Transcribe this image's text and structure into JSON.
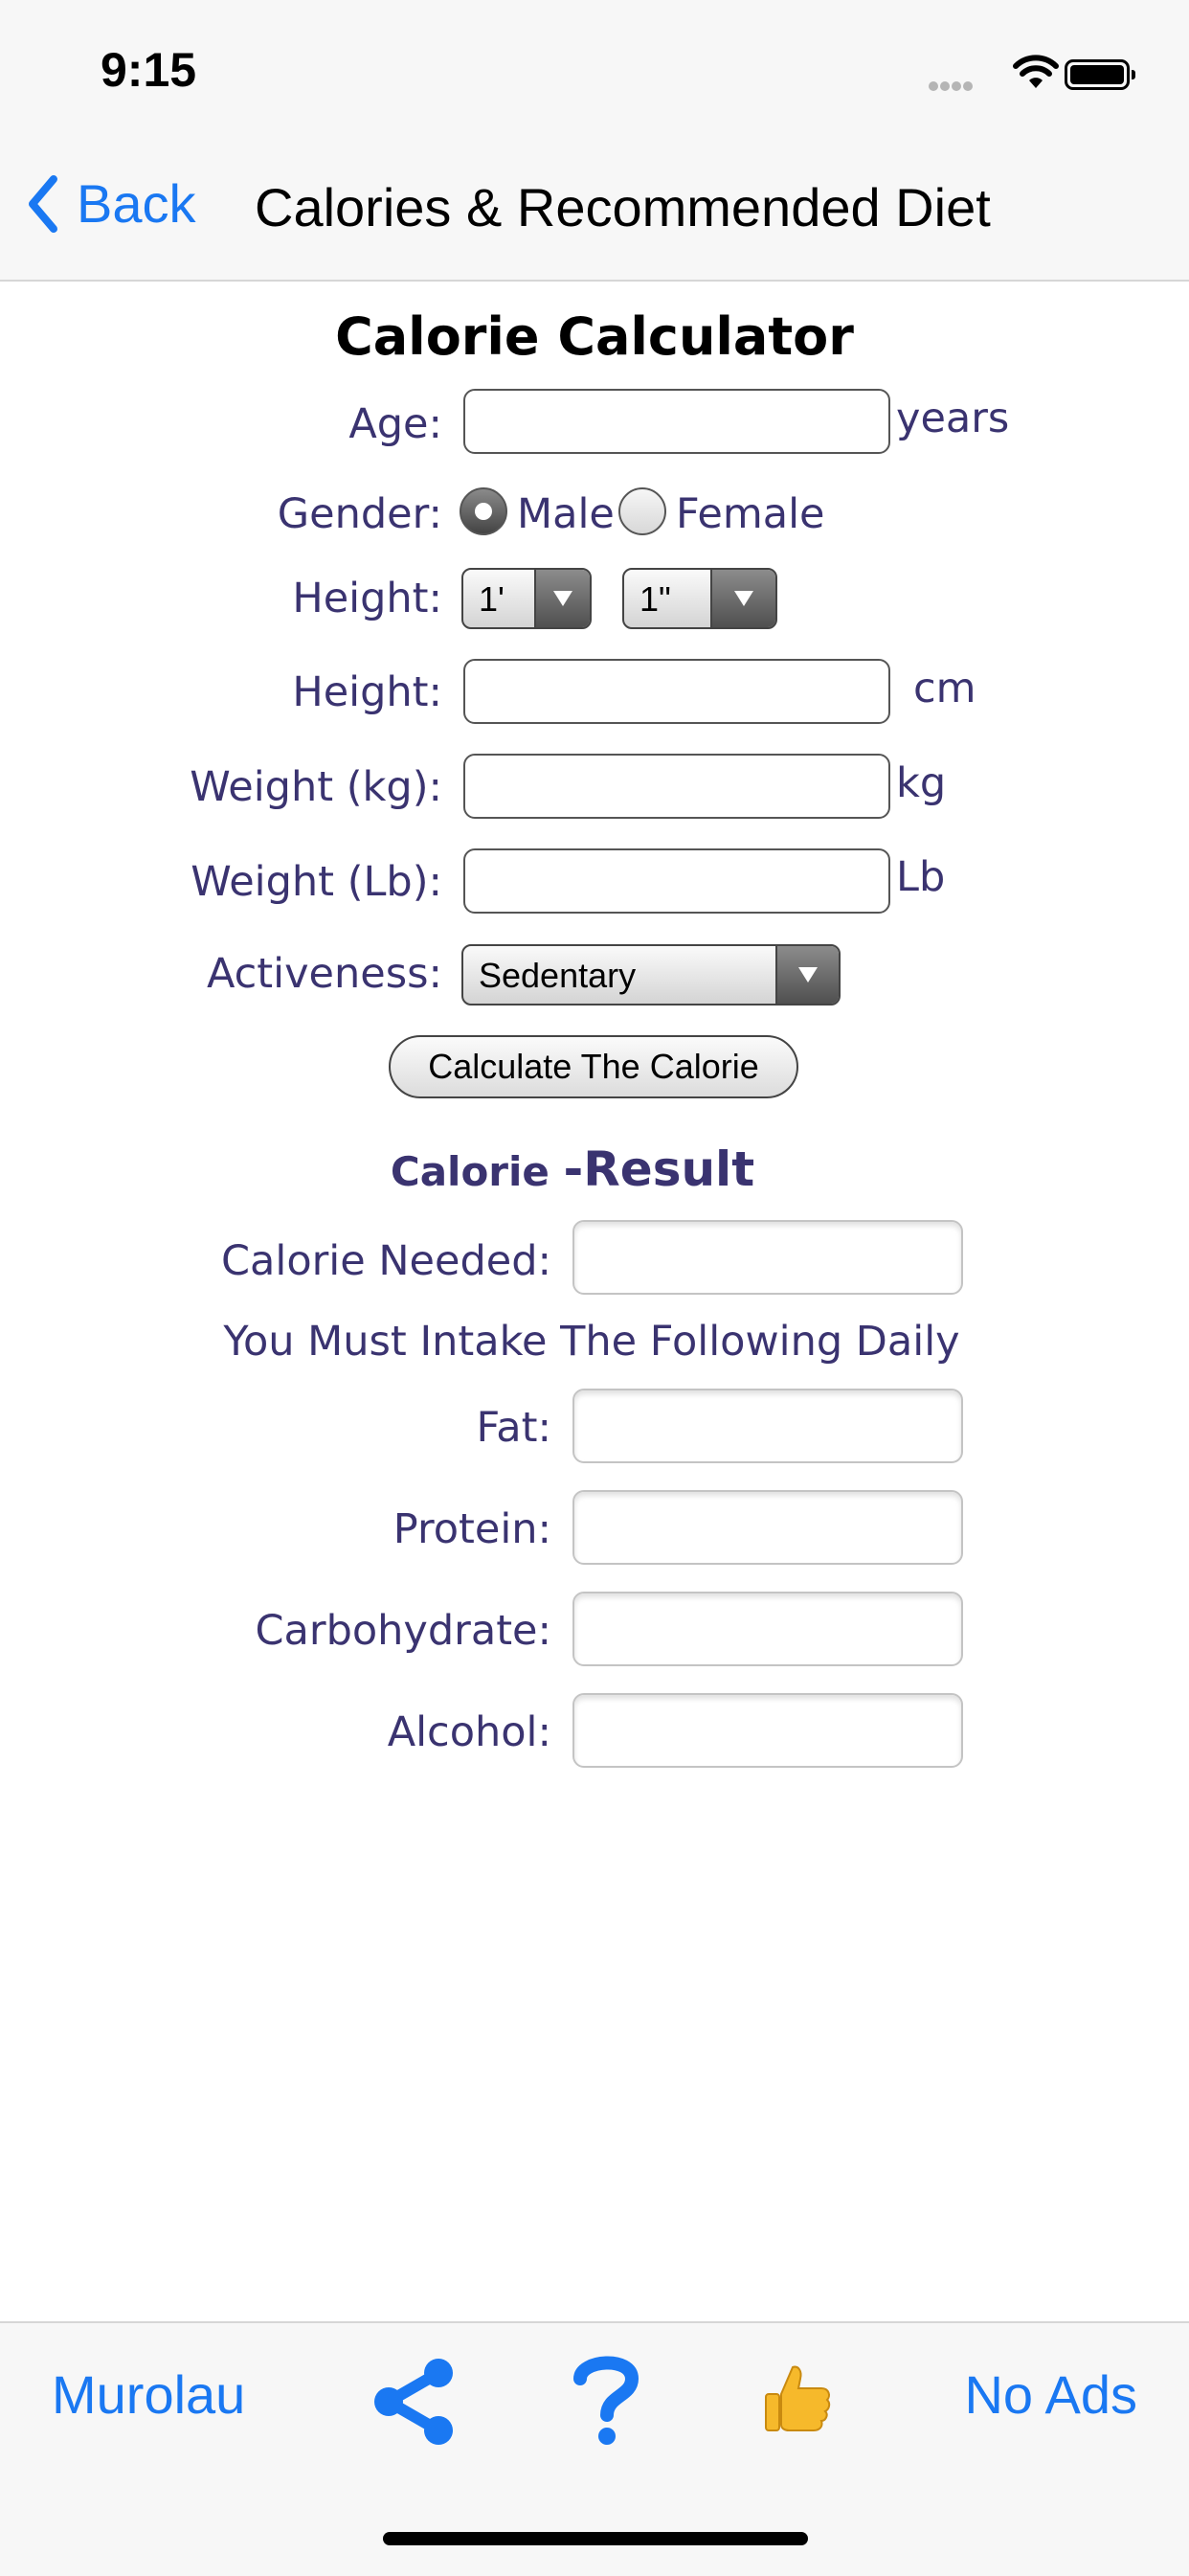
{
  "status_bar": {
    "time": "9:15"
  },
  "nav": {
    "back_label": "Back",
    "title": "Calories & Recommended Diet"
  },
  "calculator": {
    "heading": "Calorie Calculator",
    "age_label": "Age:",
    "age_unit": "years",
    "gender_label": "Gender:",
    "gender_male": "Male",
    "gender_female": "Female",
    "gender_selected": "Male",
    "height_label": "Height:",
    "height_feet": "1'",
    "height_inches": "1\"",
    "height_cm_label": "Height:",
    "height_cm_unit": "cm",
    "weight_kg_label": "Weight (kg):",
    "weight_kg_unit": "kg",
    "weight_lb_label": "Weight (Lb):",
    "weight_lb_unit": "Lb",
    "activeness_label": "Activeness:",
    "activeness_value": "Sedentary",
    "calculate_button": "Calculate The Calorie"
  },
  "result": {
    "title_part1": "Calorie ",
    "title_part2": "-Result",
    "calorie_needed_label": "Calorie Needed:",
    "intake_text": "You Must Intake The Following Daily",
    "fat_label": "Fat:",
    "protein_label": "Protein:",
    "carbohydrate_label": "Carbohydrate:",
    "alcohol_label": "Alcohol:"
  },
  "toolbar": {
    "left_label": "Murolau",
    "share_icon": "share-icon",
    "help_icon": "question-icon",
    "like_icon": "thumbs-up-icon",
    "right_label": "No Ads"
  },
  "colors": {
    "accent": "#1a78f2",
    "label": "#3a3370"
  }
}
